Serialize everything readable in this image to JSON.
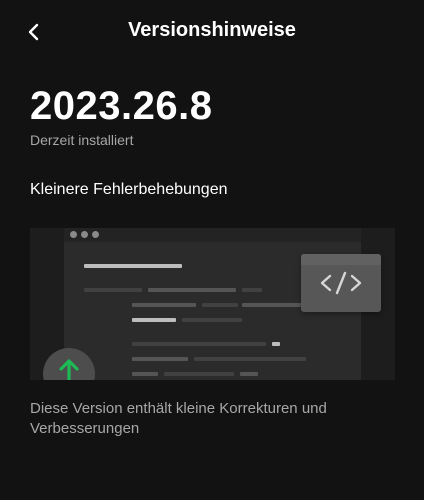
{
  "header": {
    "title": "Versionshinweise",
    "back_icon": "chevron-left-icon"
  },
  "version": {
    "number": "2023.26.8",
    "status": "Derzeit installiert"
  },
  "release": {
    "heading": "Kleinere Fehlerbehebungen",
    "description": "Diese Version enthält kleine Korrekturen und Verbesserungen"
  },
  "illustration": {
    "icons": [
      "code-icon",
      "arrow-up-icon"
    ],
    "colors": {
      "accent": "#1db954",
      "background": "#121212"
    }
  }
}
